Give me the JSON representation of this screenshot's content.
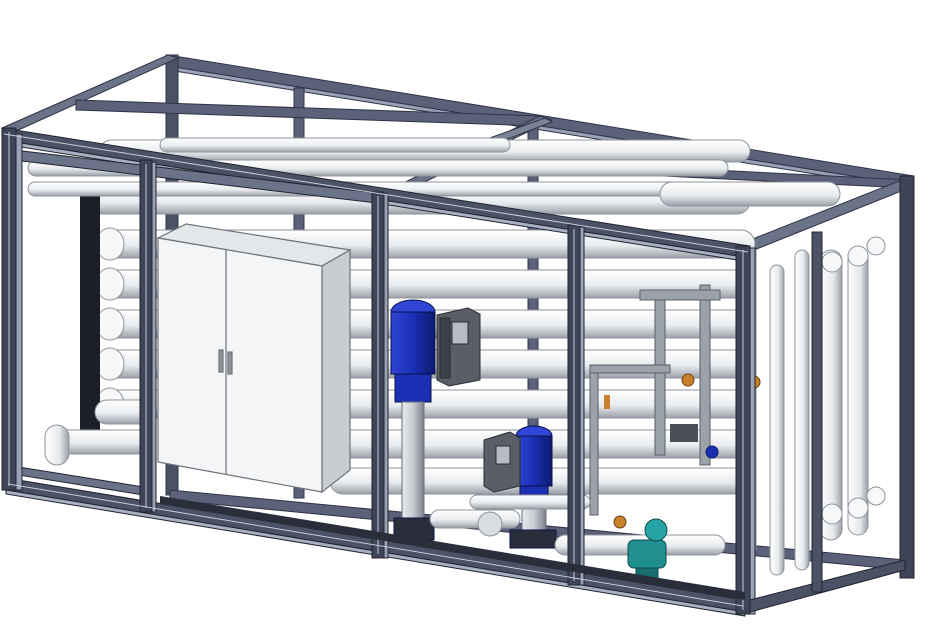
{
  "image": {
    "subject": "containerized-filtration-skid",
    "colors": {
      "background": "#ffffff",
      "frame": "#3a4052",
      "frame_light": "#8a92a6",
      "pipe": "#eef0f2",
      "pipe_shade": "#b9bec4",
      "cabinet": "#f4f5f6",
      "pump_blue": "#1a2fb4",
      "pump_dark": "#0d1a6e",
      "vfd_gray": "#5a5e66",
      "valve_teal": "#1f8f8f",
      "fitting_orange": "#c9802a"
    }
  }
}
